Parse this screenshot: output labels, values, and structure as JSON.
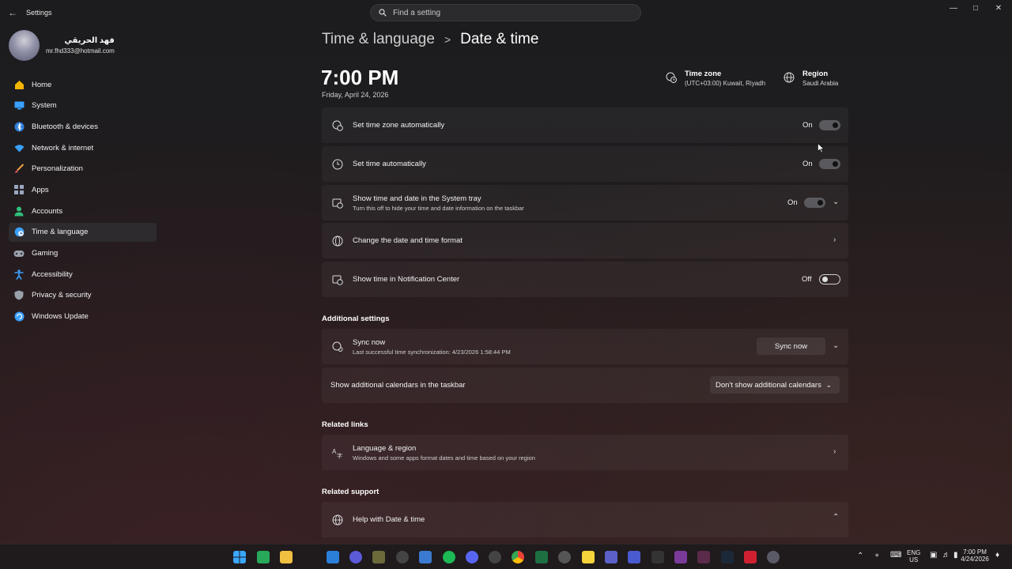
{
  "window": {
    "app_title": "Settings",
    "search_placeholder": "Find a setting"
  },
  "profile": {
    "name": "فهد الحريقي",
    "email": "mr.fhd333@hotmail.com"
  },
  "sidebar": {
    "items": [
      {
        "label": "Home",
        "icon": "home-icon",
        "color": "#f4b400"
      },
      {
        "label": "System",
        "icon": "system-icon",
        "color": "#3aa0ff"
      },
      {
        "label": "Bluetooth & devices",
        "icon": "bluetooth-icon",
        "color": "#3aa0ff"
      },
      {
        "label": "Network & internet",
        "icon": "wifi-icon",
        "color": "#3aa0ff"
      },
      {
        "label": "Personalization",
        "icon": "brush-icon",
        "color": "#e8a040"
      },
      {
        "label": "Apps",
        "icon": "apps-icon",
        "color": "#9aa7c0"
      },
      {
        "label": "Accounts",
        "icon": "accounts-icon",
        "color": "#2ec07a"
      },
      {
        "label": "Time & language",
        "icon": "globe-clock-icon",
        "color": "#3aa0ff",
        "active": true
      },
      {
        "label": "Gaming",
        "icon": "gamepad-icon",
        "color": "#9aa0aa"
      },
      {
        "label": "Accessibility",
        "icon": "accessibility-icon",
        "color": "#3aa0ff"
      },
      {
        "label": "Privacy & security",
        "icon": "shield-icon",
        "color": "#9aa0aa"
      },
      {
        "label": "Windows Update",
        "icon": "update-icon",
        "color": "#3aa0ff"
      }
    ]
  },
  "breadcrumb": {
    "parent": "Time & language",
    "separator": ">",
    "current": "Date & time"
  },
  "clock": {
    "time": "7:00 PM",
    "date": "Friday, April 24, 2026"
  },
  "time_zone": {
    "title": "Time zone",
    "value": "(UTC+03:00) Kuwait, Riyadh"
  },
  "region": {
    "title": "Region",
    "value": "Saudi Arabia"
  },
  "settings": {
    "set_tz_auto": {
      "title": "Set time zone automatically",
      "state": "On"
    },
    "set_time_auto": {
      "title": "Set time automatically",
      "state": "On"
    },
    "tray": {
      "title": "Show time and date in the System tray",
      "sub": "Turn this off to hide your time and date information on the taskbar",
      "state": "On"
    },
    "format": {
      "title": "Change the date and time format"
    },
    "notif": {
      "title": "Show time in Notification Center",
      "state": "Off"
    }
  },
  "additional": {
    "heading": "Additional settings",
    "sync_title": "Sync now",
    "sync_sub": "Last successful time synchronization: 4/23/2026 1:58:44 PM",
    "sync_button": "Sync now",
    "calendars_title": "Show additional calendars in the taskbar",
    "calendars_value": "Don't show additional calendars"
  },
  "related_links": {
    "heading": "Related links",
    "lang_title": "Language & region",
    "lang_sub": "Windows and some apps format dates and time based on your region"
  },
  "related_support": {
    "heading": "Related support",
    "help_title": "Help with Date & time"
  },
  "taskbar": {
    "lang_top": "ENG",
    "lang_bottom": "US",
    "time": "7:00 PM",
    "date": "4/24/2026",
    "icons": [
      "windows-start-icon",
      "widgets-icon",
      "file-explorer-icon",
      "mail-icon",
      "app-icon",
      "minecraft-icon",
      "4k-downloader-icon",
      "shield-app-icon",
      "spotify-icon",
      "discord-icon",
      "steam-recorder-icon",
      "chrome-icon",
      "excel-icon",
      "game-app-icon",
      "sticky-notes-icon",
      "teams-icon",
      "app-icon-2",
      "nvidia-icon",
      "winrar-icon",
      "vs-icon",
      "steam-icon",
      "screen-recorder-icon",
      "settings-icon"
    ]
  }
}
